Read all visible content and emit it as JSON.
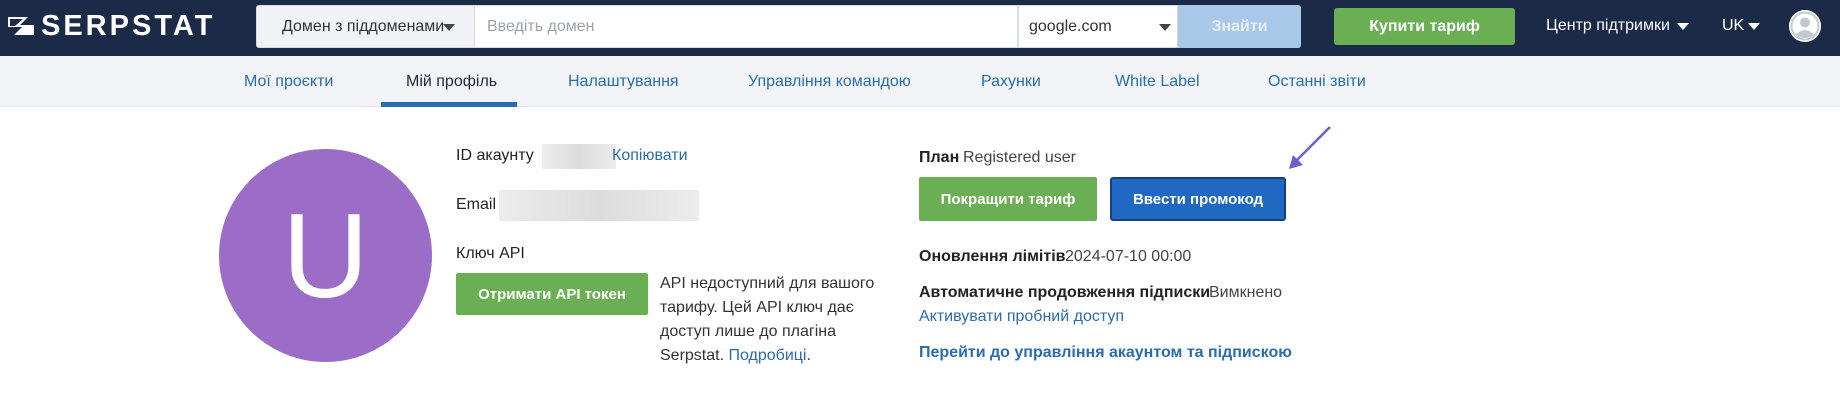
{
  "header": {
    "logo_text": "SERPSTAT",
    "scope_select": "Домен з піддоменами",
    "domain_placeholder": "Введіть домен",
    "engine_select": "google.com",
    "find_label": "Знайти",
    "buy_label": "Купити тариф",
    "support_label": "Центр підтримки",
    "lang_label": "UK"
  },
  "tabs": [
    {
      "label": "Мої проєкти"
    },
    {
      "label": "Мій профіль"
    },
    {
      "label": "Налаштування"
    },
    {
      "label": "Управління командою"
    },
    {
      "label": "Рахунки"
    },
    {
      "label": "White Label"
    },
    {
      "label": "Останні звіти"
    }
  ],
  "active_tab": "Мій профіль",
  "profile": {
    "avatar_letter": "U",
    "account_id_label": "ID акаунту",
    "copy_label": "Копіювати",
    "email_label": "Email",
    "api_key_label": "Ключ API",
    "api_button": "Отримати API токен",
    "api_note": "API недоступний для вашого тарифу. Цей API ключ дає доступ лише до плагіна Serpstat.",
    "api_note_link": "Подробиці"
  },
  "plan": {
    "label": "План",
    "value": "Registered user",
    "improve_button": "Покращити тариф",
    "promo_button": "Ввести промокод",
    "limits_label": "Оновлення лімітів",
    "limits_value": "2024-07-10 00:00",
    "autorenew_label": "Автоматичне продовження підписки",
    "autorenew_value": "Вимкнено",
    "trial_link": "Активувати пробний доступ",
    "manage_link": "Перейти до управління акаунтом та підпискою"
  },
  "colors": {
    "header_bg": "#1b2b47",
    "green": "#6aaf53",
    "blue_button": "#2168c2",
    "link": "#2a6cb0",
    "avatar": "#9b6dc6"
  }
}
